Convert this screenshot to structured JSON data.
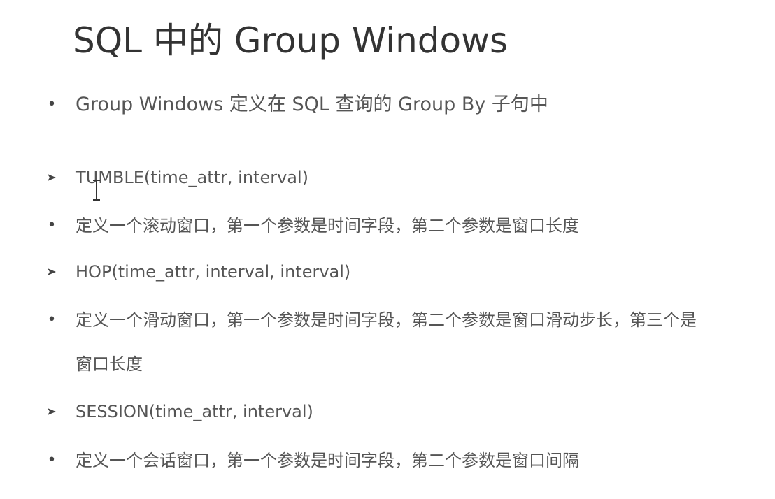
{
  "slide": {
    "title": "SQL 中的 Group Windows",
    "intro": "Group Windows 定义在 SQL 查询的 Group By 子句中",
    "items": [
      {
        "kind": "function",
        "text": "TUMBLE(time_attr, interval)"
      },
      {
        "kind": "desc",
        "text": "定义一个滚动窗口，第一个参数是时间字段，第二个参数是窗口长度"
      },
      {
        "kind": "function",
        "text": "HOP(time_attr, interval, interval)"
      },
      {
        "kind": "desc",
        "text": "定义一个滑动窗口，第一个参数是时间字段，第二个参数是窗口滑动步长，第三个是"
      },
      {
        "kind": "continuation",
        "text": "窗口长度"
      },
      {
        "kind": "function",
        "text": "SESSION(time_attr, interval)"
      },
      {
        "kind": "desc",
        "text": "定义一个会话窗口，第一个参数是时间字段，第二个参数是窗口间隔"
      }
    ]
  }
}
